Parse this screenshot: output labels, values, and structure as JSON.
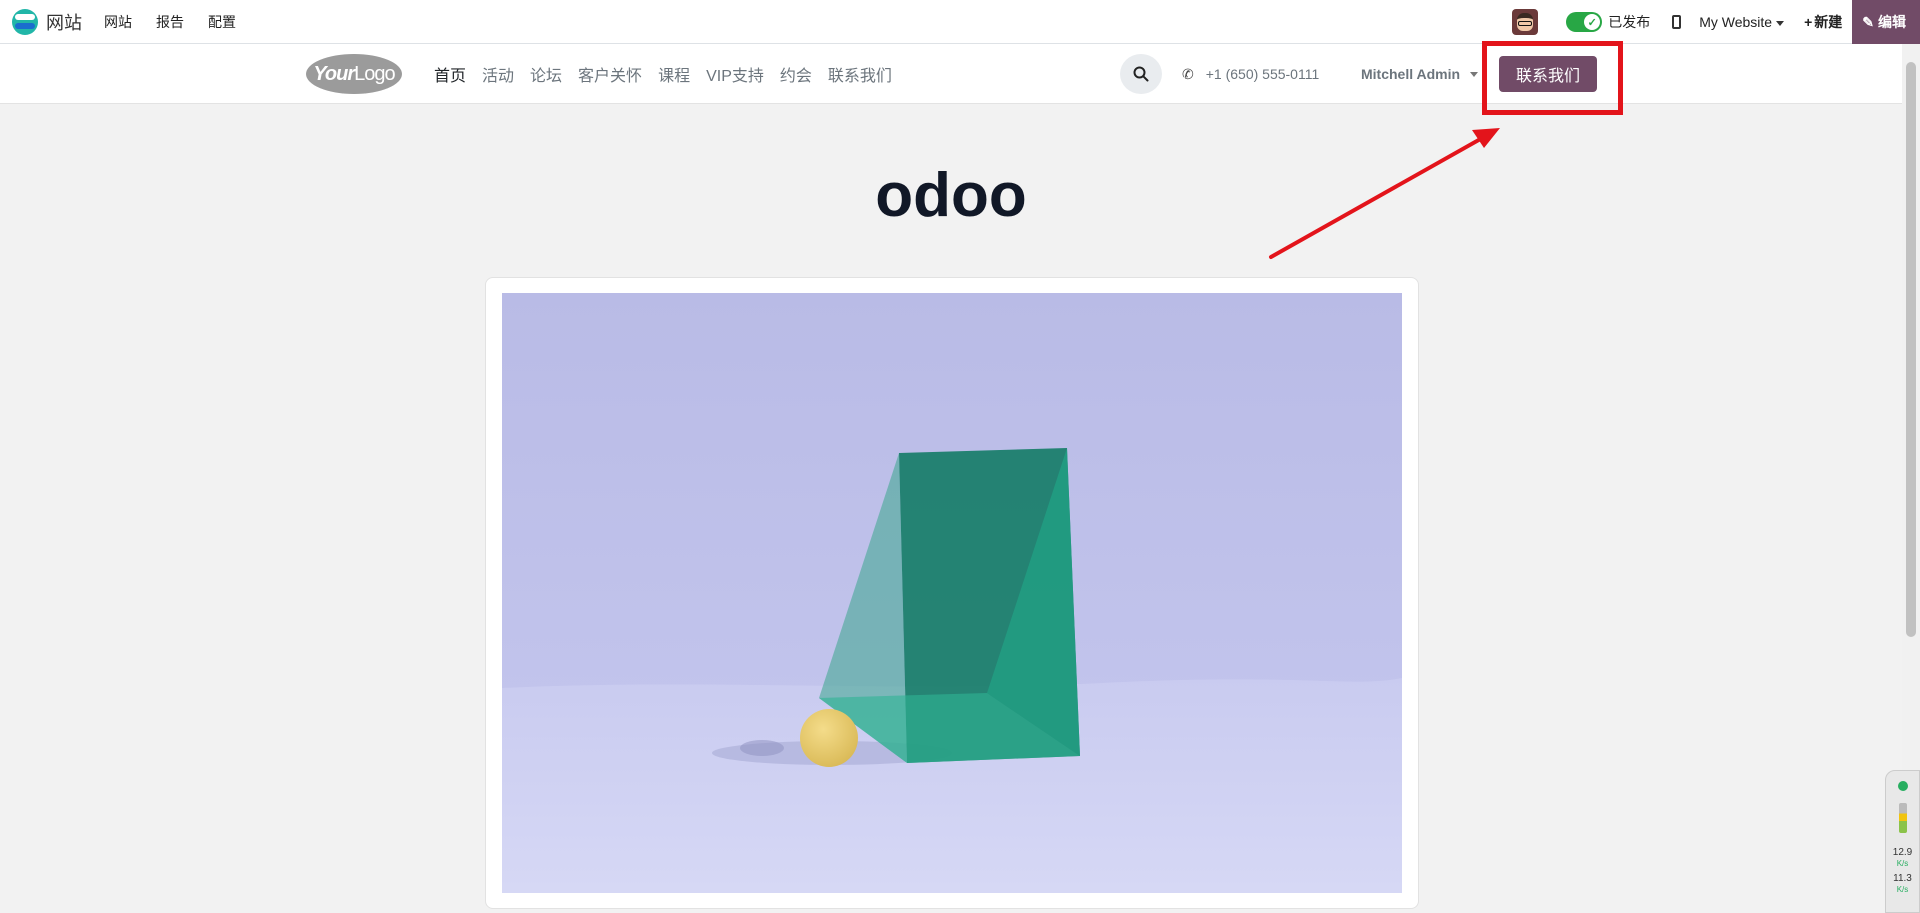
{
  "admin_bar": {
    "brand": "网站",
    "menu": [
      "网站",
      "报告",
      "配置"
    ],
    "published_label": "已发布",
    "website_select": "My Website",
    "new_label": "新建",
    "edit_label": "编辑"
  },
  "header": {
    "logo_text_1": "Your",
    "logo_text_2": "Logo",
    "nav_items": [
      "首页",
      "活动",
      "论坛",
      "客户关怀",
      "课程",
      "VIP支持",
      "约会",
      "联系我们"
    ],
    "active_nav": "首页",
    "phone": "+1 (650) 555-0111",
    "user": "Mitchell Admin",
    "cta_label": "联系我们"
  },
  "hero": {
    "title": "odoo"
  },
  "net_widget": {
    "upload_value": "12.9",
    "upload_unit": "K/s",
    "download_value": "11.3",
    "download_unit": "K/s"
  },
  "colors": {
    "brand_purple": "#714b67",
    "annotation_red": "#e3141b",
    "toggle_green": "#28a745"
  }
}
